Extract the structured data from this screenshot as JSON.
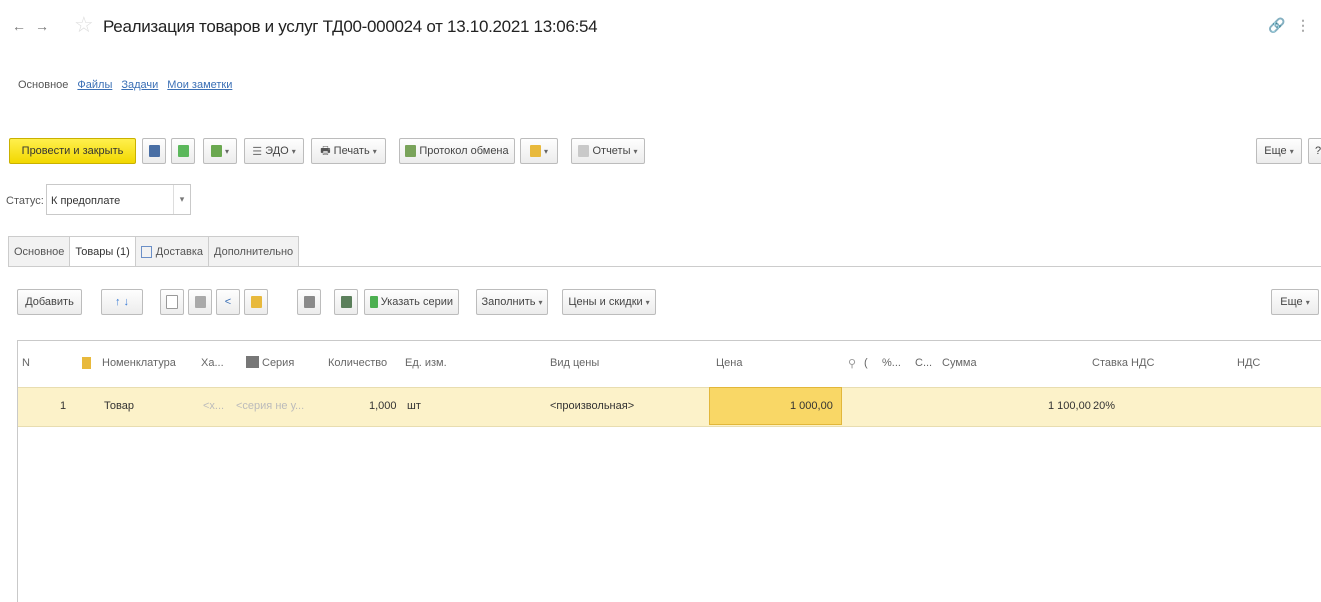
{
  "title_bar": {
    "title": "Реализация товаров и услуг ТД00-000024 от 13.10.2021 13:06:54",
    "back_glyph": "←",
    "forward_glyph": "→",
    "star_glyph": "☆",
    "link_glyph": "🔗",
    "more_glyph": "⋮"
  },
  "sublinks": {
    "main": "Основное",
    "files": "Файлы",
    "tasks": "Задачи",
    "notes": "Мои заметки"
  },
  "toolbar": {
    "post_close": "Провести и закрыть",
    "edo": "ЭДО",
    "print": "Печать",
    "exchange_protocol": "Протокол обмена",
    "reports": "Отчеты",
    "more": "Еще",
    "help": "?"
  },
  "status": {
    "label": "Статус:",
    "value": "К предоплате"
  },
  "tabs": [
    {
      "label": "Основное"
    },
    {
      "label": "Товары (1)"
    },
    {
      "label": "Доставка"
    },
    {
      "label": "Дополнительно"
    }
  ],
  "goods_toolbar": {
    "add": "Добавить",
    "specify_series": "Указать серии",
    "fill": "Заполнить",
    "prices_discounts": "Цены и скидки",
    "more": "Еще"
  },
  "table": {
    "columns": [
      "N",
      "Номенклатура",
      "Ха...",
      "Серия",
      "Количество",
      "Ед. изм.",
      "Вид цены",
      "Цена",
      "(",
      "%...",
      "С...",
      "Сумма",
      "Ставка НДС",
      "НДС"
    ],
    "rows": [
      {
        "n": "1",
        "item": "Товар",
        "characteristic": "<х...",
        "series": "<серия не у...",
        "qty": "1,000",
        "unit": "шт",
        "price_type": "<произвольная>",
        "price": "1 000,00",
        "sum": "1 100,00",
        "vat_rate": "20%"
      }
    ]
  },
  "colors": {
    "primary_button": "#f2d800",
    "selected_row": "#fcf2c9",
    "active_cell": "#f9d766",
    "link": "#3a6fb5"
  }
}
